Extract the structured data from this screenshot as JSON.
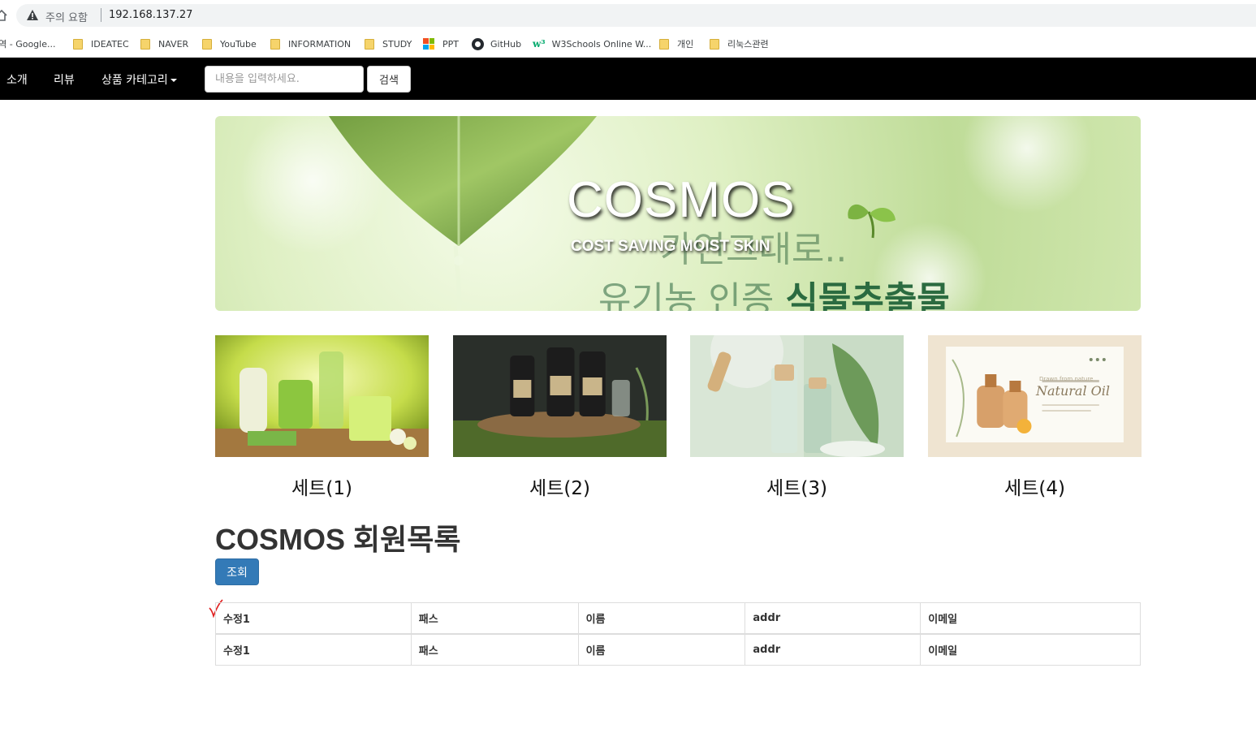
{
  "browser": {
    "warning_text": "주의 요함",
    "url": "192.168.137.27",
    "bookmarks": [
      {
        "label": "번역 - Google...",
        "icon": "none"
      },
      {
        "label": "IDEATEC",
        "icon": "folder-icon"
      },
      {
        "label": "NAVER",
        "icon": "folder-icon"
      },
      {
        "label": "YouTube",
        "icon": "folder-icon"
      },
      {
        "label": "INFORMATION",
        "icon": "folder-icon"
      },
      {
        "label": "STUDY",
        "icon": "folder-icon"
      },
      {
        "label": "PPT",
        "icon": "microsoft-icon"
      },
      {
        "label": "GitHub",
        "icon": "github-icon"
      },
      {
        "label": "W3Schools Online W...",
        "icon": "w3schools-icon"
      },
      {
        "label": "개인",
        "icon": "folder-icon"
      },
      {
        "label": "리눅스관련",
        "icon": "folder-icon"
      }
    ]
  },
  "navbar": {
    "links": [
      "소개",
      "리뷰",
      "상품 카테고리"
    ],
    "search_placeholder": "내용을 입력하세요.",
    "search_button": "검색"
  },
  "banner": {
    "title": "COSMOS",
    "subtitle": "COST SAVING MOIST SKIN",
    "overlay_line1": "가연그대로..",
    "overlay_line2_prefix": "유기농 인증 ",
    "overlay_line2_bold": "식물추출물"
  },
  "products": [
    {
      "label": "세트(1)"
    },
    {
      "label": "세트(2)"
    },
    {
      "label": "세트(3)"
    },
    {
      "label": "세트(4)"
    }
  ],
  "members": {
    "title": "COSMOS 회원목록",
    "query_button": "조회",
    "columns": [
      "수정1",
      "패스",
      "이름",
      "addr",
      "이메일"
    ],
    "rows": [
      [
        "수정1",
        "패스",
        "이름",
        "addr",
        "이메일"
      ]
    ]
  },
  "colors": {
    "navbar_bg": "#000000",
    "primary_button": "#337ab7"
  }
}
